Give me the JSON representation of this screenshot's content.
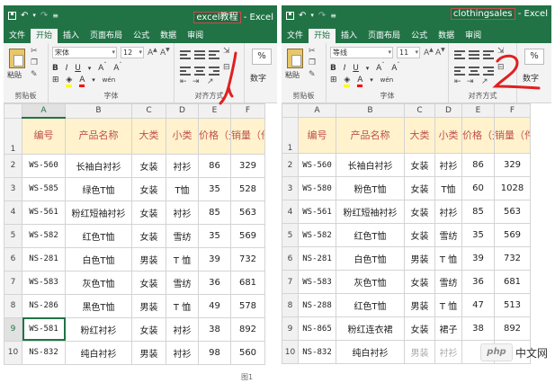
{
  "left_window": {
    "title_filename": "excel教程",
    "title_suffix": " - Excel",
    "tabs": [
      "文件",
      "开始",
      "插入",
      "页面布局",
      "公式",
      "数据",
      "审阅"
    ],
    "active_tab": "开始",
    "ribbon": {
      "paste_label": "粘贴",
      "clipboard_label": "剪贴板",
      "font_name": "宋体",
      "font_size": "12",
      "font_group_label": "字体",
      "align_group_label": "对齐方式",
      "number_label": "数字",
      "percent": "%",
      "wen_label": "wén"
    },
    "column_headers": [
      "A",
      "B",
      "C",
      "D",
      "E",
      "F"
    ],
    "selected_column": "A",
    "selected_row": "9",
    "header_cells": [
      "编号",
      "产品名称",
      "大类",
      "小类",
      "价格（元）",
      "销量（件）"
    ],
    "rows": [
      {
        "n": "2",
        "cells": [
          "WS-560",
          "长袖白衬衫",
          "女装",
          "衬衫",
          "86",
          "329"
        ]
      },
      {
        "n": "3",
        "cells": [
          "WS-585",
          "绿色T恤",
          "女装",
          "T恤",
          "35",
          "528"
        ]
      },
      {
        "n": "4",
        "cells": [
          "WS-561",
          "粉红短袖衬衫",
          "女装",
          "衬衫",
          "85",
          "563"
        ]
      },
      {
        "n": "5",
        "cells": [
          "WS-582",
          "红色T恤",
          "女装",
          "雪纺",
          "35",
          "569"
        ]
      },
      {
        "n": "6",
        "cells": [
          "NS-281",
          "白色T恤",
          "男装",
          "T 恤",
          "39",
          "732"
        ]
      },
      {
        "n": "7",
        "cells": [
          "WS-583",
          "灰色T恤",
          "女装",
          "雪纺",
          "36",
          "681"
        ]
      },
      {
        "n": "8",
        "cells": [
          "NS-286",
          "黑色T恤",
          "男装",
          "T 恤",
          "49",
          "578"
        ]
      },
      {
        "n": "9",
        "cells": [
          "WS-581",
          "粉红衬衫",
          "女装",
          "衬衫",
          "38",
          "892"
        ]
      },
      {
        "n": "10",
        "cells": [
          "NS-832",
          "纯白衬衫",
          "男装",
          "衬衫",
          "98",
          "560"
        ]
      }
    ]
  },
  "right_window": {
    "title_filename": "clothingsales",
    "title_suffix": " - Excel",
    "tabs": [
      "文件",
      "开始",
      "插入",
      "页面布局",
      "公式",
      "数据",
      "审阅"
    ],
    "active_tab": "开始",
    "ribbon": {
      "paste_label": "粘贴",
      "clipboard_label": "剪贴板",
      "font_name": "等线",
      "font_size": "11",
      "font_group_label": "字体",
      "align_group_label": "对齐方式",
      "number_label": "数字",
      "percent": "%",
      "wen_label": "wén"
    },
    "column_headers": [
      "A",
      "B",
      "C",
      "D",
      "E",
      "F"
    ],
    "header_cells": [
      "编号",
      "产品名称",
      "大类",
      "小类",
      "价格（元）",
      "销量（件）"
    ],
    "rows": [
      {
        "n": "2",
        "cells": [
          "WS-560",
          "长袖白衬衫",
          "女装",
          "衬衫",
          "86",
          "329"
        ]
      },
      {
        "n": "3",
        "cells": [
          "WS-580",
          "粉色T恤",
          "女装",
          "T恤",
          "60",
          "1028"
        ]
      },
      {
        "n": "4",
        "cells": [
          "WS-561",
          "粉红短袖衬衫",
          "女装",
          "衬衫",
          "85",
          "563"
        ]
      },
      {
        "n": "5",
        "cells": [
          "WS-582",
          "红色T恤",
          "女装",
          "雪纺",
          "35",
          "569"
        ]
      },
      {
        "n": "6",
        "cells": [
          "NS-281",
          "白色T恤",
          "男装",
          "T 恤",
          "39",
          "732"
        ]
      },
      {
        "n": "7",
        "cells": [
          "WS-583",
          "灰色T恤",
          "女装",
          "雪纺",
          "36",
          "681"
        ]
      },
      {
        "n": "8",
        "cells": [
          "NS-288",
          "红色T恤",
          "男装",
          "T 恤",
          "47",
          "513"
        ]
      },
      {
        "n": "9",
        "cells": [
          "NS-865",
          "粉红连衣裙",
          "女装",
          "裙子",
          "38",
          "892"
        ]
      },
      {
        "n": "10",
        "cells": [
          "NS-832",
          "纯白衬衫",
          "男装",
          "衬衫",
          "",
          ""
        ]
      }
    ]
  },
  "watermark": {
    "logo": "php",
    "text": "中文网"
  },
  "caption": "图1",
  "annotations": {
    "left_mark": "1",
    "right_mark": "2"
  },
  "colors": {
    "excel_green": "#217346",
    "header_fill": "#fff2cc",
    "header_text": "#c0504d",
    "marker_red": "#e02020"
  }
}
